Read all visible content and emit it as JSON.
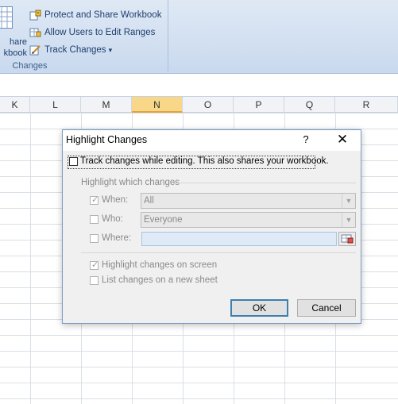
{
  "ribbon": {
    "share_label_line1": "hare",
    "share_label_line2": "kbook",
    "items": [
      {
        "label": "Protect and Share Workbook",
        "icon": "protect-share-icon"
      },
      {
        "label": "Allow Users to Edit Ranges",
        "icon": "edit-ranges-icon"
      },
      {
        "label": "Track Changes",
        "icon": "track-changes-icon",
        "dropdown": "▾"
      }
    ],
    "group_label": "Changes"
  },
  "columns": [
    "K",
    "L",
    "M",
    "N",
    "O",
    "P",
    "Q",
    "R"
  ],
  "active_column": "N",
  "dialog": {
    "title": "Highlight Changes",
    "help": "?",
    "close": "✕",
    "track_changes_label": "Track changes while editing. This also shares your workbook.",
    "track_changes_checked": false,
    "section_label": "Highlight which changes",
    "when": {
      "label": "When:",
      "checked": true,
      "value": "All"
    },
    "who": {
      "label": "Who:",
      "checked": false,
      "value": "Everyone"
    },
    "where": {
      "label": "Where:",
      "checked": false,
      "value": ""
    },
    "highlight_on_screen": {
      "label": "Highlight changes on screen",
      "checked": true
    },
    "list_on_new_sheet": {
      "label": "List changes on a new sheet",
      "checked": false
    },
    "ok_label": "OK",
    "cancel_label": "Cancel"
  },
  "colors": {
    "ribbon_text": "#1e3f6e",
    "active_column": "#f8d888",
    "default_button_border": "#3c7fb1"
  }
}
